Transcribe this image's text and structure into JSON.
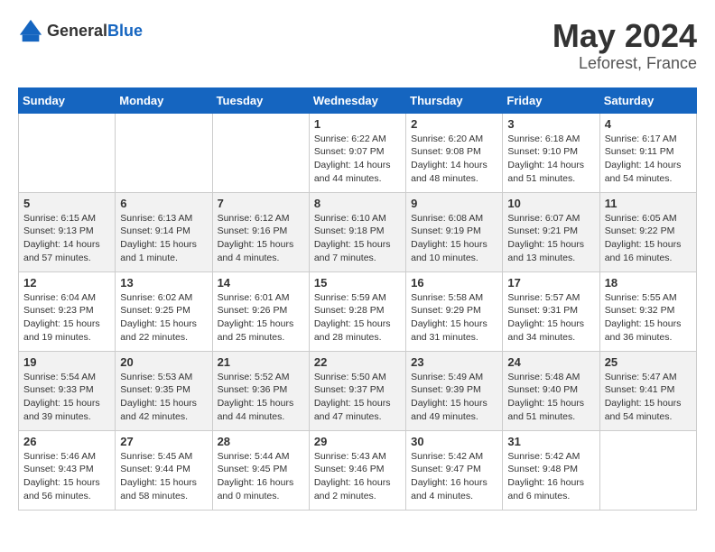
{
  "header": {
    "logo_general": "General",
    "logo_blue": "Blue",
    "title": "May 2024",
    "location": "Leforest, France"
  },
  "weekdays": [
    "Sunday",
    "Monday",
    "Tuesday",
    "Wednesday",
    "Thursday",
    "Friday",
    "Saturday"
  ],
  "weeks": [
    {
      "days": [
        {
          "num": "",
          "content": ""
        },
        {
          "num": "",
          "content": ""
        },
        {
          "num": "",
          "content": ""
        },
        {
          "num": "1",
          "content": "Sunrise: 6:22 AM\nSunset: 9:07 PM\nDaylight: 14 hours\nand 44 minutes."
        },
        {
          "num": "2",
          "content": "Sunrise: 6:20 AM\nSunset: 9:08 PM\nDaylight: 14 hours\nand 48 minutes."
        },
        {
          "num": "3",
          "content": "Sunrise: 6:18 AM\nSunset: 9:10 PM\nDaylight: 14 hours\nand 51 minutes."
        },
        {
          "num": "4",
          "content": "Sunrise: 6:17 AM\nSunset: 9:11 PM\nDaylight: 14 hours\nand 54 minutes."
        }
      ]
    },
    {
      "days": [
        {
          "num": "5",
          "content": "Sunrise: 6:15 AM\nSunset: 9:13 PM\nDaylight: 14 hours\nand 57 minutes."
        },
        {
          "num": "6",
          "content": "Sunrise: 6:13 AM\nSunset: 9:14 PM\nDaylight: 15 hours\nand 1 minute."
        },
        {
          "num": "7",
          "content": "Sunrise: 6:12 AM\nSunset: 9:16 PM\nDaylight: 15 hours\nand 4 minutes."
        },
        {
          "num": "8",
          "content": "Sunrise: 6:10 AM\nSunset: 9:18 PM\nDaylight: 15 hours\nand 7 minutes."
        },
        {
          "num": "9",
          "content": "Sunrise: 6:08 AM\nSunset: 9:19 PM\nDaylight: 15 hours\nand 10 minutes."
        },
        {
          "num": "10",
          "content": "Sunrise: 6:07 AM\nSunset: 9:21 PM\nDaylight: 15 hours\nand 13 minutes."
        },
        {
          "num": "11",
          "content": "Sunrise: 6:05 AM\nSunset: 9:22 PM\nDaylight: 15 hours\nand 16 minutes."
        }
      ]
    },
    {
      "days": [
        {
          "num": "12",
          "content": "Sunrise: 6:04 AM\nSunset: 9:23 PM\nDaylight: 15 hours\nand 19 minutes."
        },
        {
          "num": "13",
          "content": "Sunrise: 6:02 AM\nSunset: 9:25 PM\nDaylight: 15 hours\nand 22 minutes."
        },
        {
          "num": "14",
          "content": "Sunrise: 6:01 AM\nSunset: 9:26 PM\nDaylight: 15 hours\nand 25 minutes."
        },
        {
          "num": "15",
          "content": "Sunrise: 5:59 AM\nSunset: 9:28 PM\nDaylight: 15 hours\nand 28 minutes."
        },
        {
          "num": "16",
          "content": "Sunrise: 5:58 AM\nSunset: 9:29 PM\nDaylight: 15 hours\nand 31 minutes."
        },
        {
          "num": "17",
          "content": "Sunrise: 5:57 AM\nSunset: 9:31 PM\nDaylight: 15 hours\nand 34 minutes."
        },
        {
          "num": "18",
          "content": "Sunrise: 5:55 AM\nSunset: 9:32 PM\nDaylight: 15 hours\nand 36 minutes."
        }
      ]
    },
    {
      "days": [
        {
          "num": "19",
          "content": "Sunrise: 5:54 AM\nSunset: 9:33 PM\nDaylight: 15 hours\nand 39 minutes."
        },
        {
          "num": "20",
          "content": "Sunrise: 5:53 AM\nSunset: 9:35 PM\nDaylight: 15 hours\nand 42 minutes."
        },
        {
          "num": "21",
          "content": "Sunrise: 5:52 AM\nSunset: 9:36 PM\nDaylight: 15 hours\nand 44 minutes."
        },
        {
          "num": "22",
          "content": "Sunrise: 5:50 AM\nSunset: 9:37 PM\nDaylight: 15 hours\nand 47 minutes."
        },
        {
          "num": "23",
          "content": "Sunrise: 5:49 AM\nSunset: 9:39 PM\nDaylight: 15 hours\nand 49 minutes."
        },
        {
          "num": "24",
          "content": "Sunrise: 5:48 AM\nSunset: 9:40 PM\nDaylight: 15 hours\nand 51 minutes."
        },
        {
          "num": "25",
          "content": "Sunrise: 5:47 AM\nSunset: 9:41 PM\nDaylight: 15 hours\nand 54 minutes."
        }
      ]
    },
    {
      "days": [
        {
          "num": "26",
          "content": "Sunrise: 5:46 AM\nSunset: 9:43 PM\nDaylight: 15 hours\nand 56 minutes."
        },
        {
          "num": "27",
          "content": "Sunrise: 5:45 AM\nSunset: 9:44 PM\nDaylight: 15 hours\nand 58 minutes."
        },
        {
          "num": "28",
          "content": "Sunrise: 5:44 AM\nSunset: 9:45 PM\nDaylight: 16 hours\nand 0 minutes."
        },
        {
          "num": "29",
          "content": "Sunrise: 5:43 AM\nSunset: 9:46 PM\nDaylight: 16 hours\nand 2 minutes."
        },
        {
          "num": "30",
          "content": "Sunrise: 5:42 AM\nSunset: 9:47 PM\nDaylight: 16 hours\nand 4 minutes."
        },
        {
          "num": "31",
          "content": "Sunrise: 5:42 AM\nSunset: 9:48 PM\nDaylight: 16 hours\nand 6 minutes."
        },
        {
          "num": "",
          "content": ""
        }
      ]
    }
  ]
}
